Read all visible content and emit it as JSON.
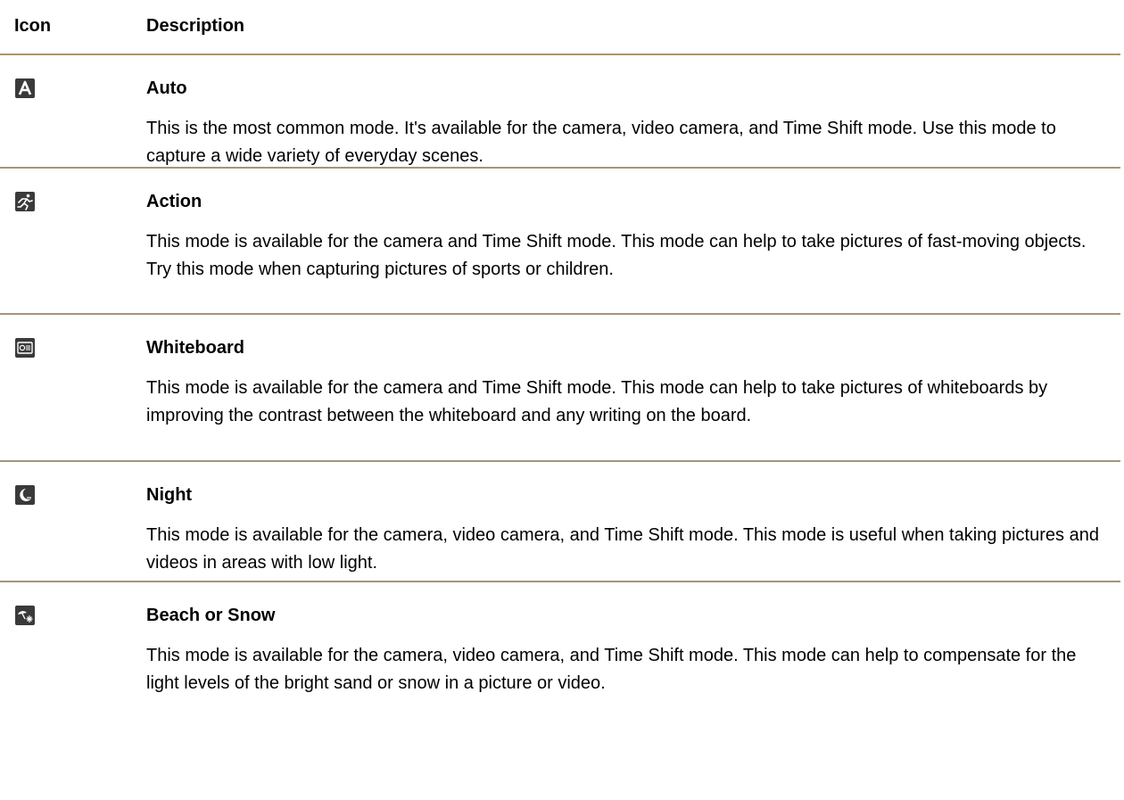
{
  "header": {
    "icon_label": "Icon",
    "description_label": "Description"
  },
  "rows": [
    {
      "icon": "auto-mode-icon",
      "title": "Auto",
      "description": "This is the most common mode. It's available for the camera, video camera, and Time Shift mode. Use this mode to capture a wide variety of everyday scenes."
    },
    {
      "icon": "action-mode-icon",
      "title": "Action",
      "description": "This mode is available for the camera and Time Shift mode. This mode can help to take pictures of fast-moving objects. Try this mode when capturing pictures of sports or children."
    },
    {
      "icon": "whiteboard-mode-icon",
      "title": "Whiteboard",
      "description": "This mode is available for the camera and Time Shift mode. This mode can help to take pictures of whiteboards by improving the contrast between the whiteboard and any writing on the board."
    },
    {
      "icon": "night-mode-icon",
      "title": "Night",
      "description": "This mode is available for the camera, video camera, and Time Shift mode. This mode is useful when taking pictures and videos in areas with low light."
    },
    {
      "icon": "beach-snow-mode-icon",
      "title": "Beach or Snow",
      "description": "This mode is available for the camera, video camera, and Time Shift mode. This mode can help to compensate for the light levels of the bright sand or snow in a picture or video."
    }
  ],
  "colors": {
    "rule": "#a89477",
    "icon_bg": "#3a3a3a",
    "icon_fg": "#ffffff"
  }
}
